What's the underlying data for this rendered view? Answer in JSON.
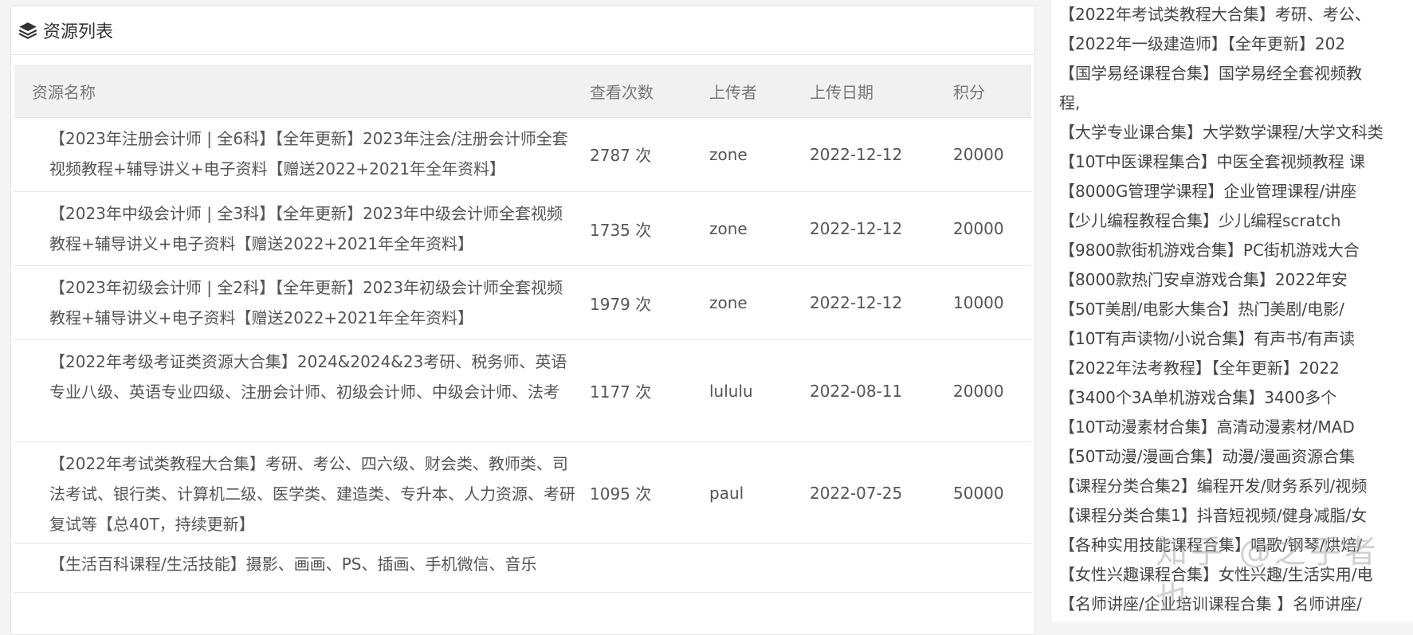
{
  "panel": {
    "title": "资源列表",
    "icon": "layers-icon"
  },
  "table": {
    "headers": {
      "name": "资源名称",
      "views": "查看次数",
      "uploader": "上传者",
      "date": "上传日期",
      "points": "积分"
    },
    "rows": [
      {
        "name": "【2023年注册会计师 | 全6科】【全年更新】2023年注会/注册会计师全套视频教程+辅导讲义+电子资料【赠送2022+2021年全年资料】",
        "views": "2787 次",
        "uploader": "zone",
        "date": "2022-12-12",
        "points": "20000"
      },
      {
        "name": "【2023年中级会计师 | 全3科】【全年更新】2023年中级会计师全套视频教程+辅导讲义+电子资料【赠送2022+2021年全年资料】",
        "views": "1735 次",
        "uploader": "zone",
        "date": "2022-12-12",
        "points": "20000"
      },
      {
        "name": "【2023年初级会计师 | 全2科】【全年更新】2023年初级会计师全套视频教程+辅导讲义+电子资料【赠送2022+2021年全年资料】",
        "views": "1979 次",
        "uploader": "zone",
        "date": "2022-12-12",
        "points": "10000"
      },
      {
        "name": "【2022年考级考证类资源大合集】2024&2024&23考研、税务师、英语专业八级、英语专业四级、注册会计师、初级会计师、中级会计师、法考",
        "views": "1177 次",
        "uploader": "lululu",
        "date": "2022-08-11",
        "points": "20000"
      },
      {
        "name": "【2022年考试类教程大合集】考研、考公、四六级、财会类、教师类、司法考试、银行类、计算机二级、医学类、建造类、专升本、人力资源、考研复试等【总40T，持续更新】",
        "views": "1095 次",
        "uploader": "paul",
        "date": "2022-07-25",
        "points": "50000"
      },
      {
        "name": "【生活百科课程/生活技能】摄影、画画、PS、插画、手机微信、音乐",
        "views": "",
        "uploader": "",
        "date": "",
        "points": ""
      }
    ]
  },
  "sidebar": {
    "items": [
      "【2022年考试类教程大合集】考研、考公、",
      "【2022年一级建造师】【全年更新】202",
      "【国学易经课程合集】国学易经全套视频教",
      "程,",
      "【大学专业课合集】大学数学课程/大学文科类",
      "【10T中医课程集合】中医全套视频教程 课",
      "【8000G管理学课程】企业管理课程/讲座",
      "【少儿编程教程合集】少儿编程scratch",
      "【9800款街机游戏合集】PC街机游戏大合",
      "【8000款热门安卓游戏合集】2022年安",
      "【50T美剧/电影大集合】热门美剧/电影/",
      "【10T有声读物/小说合集】有声书/有声读",
      "【2022年法考教程】【全年更新】2022",
      "【3400个3A单机游戏合集】3400多个",
      "【10T动漫素材合集】高清动漫素材/MAD",
      "【50T动漫/漫画合集】动漫/漫画资源合集",
      "【课程分类合集2】编程开发/财务系列/视频",
      "【课程分类合集1】抖音短视频/健身减脂/女",
      "【各种实用技能课程合集】唱歌/钢琴/烘焙/",
      "【女性兴趣课程合集】女性兴趣/生活实用/电",
      "【名师讲座/企业培训课程合集 】名师讲座/"
    ]
  },
  "watermark": "知乎 @之乎者也"
}
